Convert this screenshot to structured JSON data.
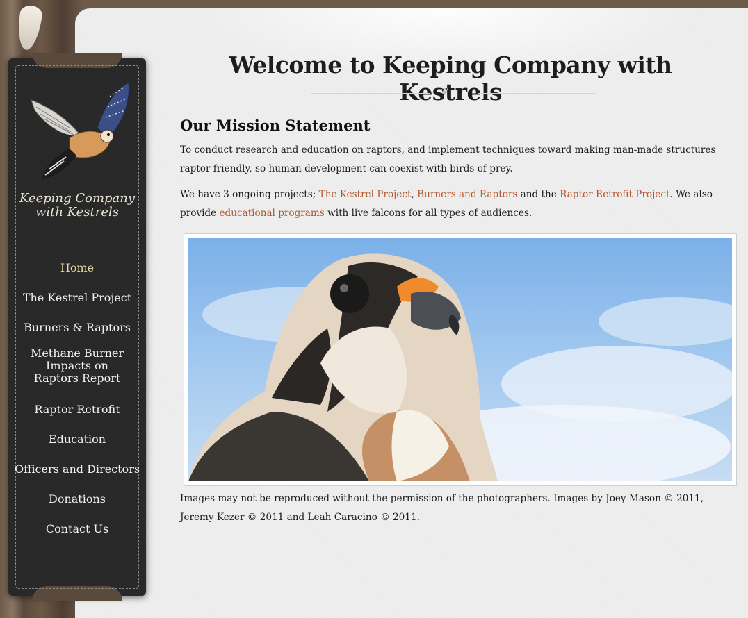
{
  "site": {
    "logo_text_line1": "Keeping Company",
    "logo_text_line2": "with Kestrels"
  },
  "nav": {
    "items": [
      {
        "label": "Home",
        "active": true
      },
      {
        "label": "The Kestrel Project"
      },
      {
        "label": "Burners & Raptors"
      },
      {
        "label": "Methane Burner Impacts on Raptors Report"
      },
      {
        "label": "Raptor Retrofit"
      },
      {
        "label": "Education"
      },
      {
        "label": "Officers and Directors"
      },
      {
        "label": "Donations"
      },
      {
        "label": "Contact Us"
      }
    ]
  },
  "main": {
    "title": "Welcome to Keeping Company with Kestrels",
    "section_title": "Our Mission Statement",
    "mission_text": "To conduct research and education on raptors, and implement techniques toward making man-made structures raptor friendly, so human development can coexist with birds of prey.",
    "projects": {
      "prefix": "We have 3 ongoing projects; ",
      "link1": "The Kestrel Project",
      "sep1": ", ",
      "link2": "Burners and Raptors",
      "sep2": " and the ",
      "link3": "Raptor Retrofit Project",
      "mid": ". We also provide ",
      "link4": "educational programs",
      "suffix": " with live falcons for all types of audiences."
    },
    "credits": "Images may not be reproduced without the permission of the photographers. Images by Joey Mason © 2011, Jeremy Kezer © 2011 and Leah Caracino © 2011."
  },
  "colors": {
    "link": "#b2572e",
    "nav_active": "#e7d79c",
    "sidebar_bg": "#2b2b2b"
  }
}
